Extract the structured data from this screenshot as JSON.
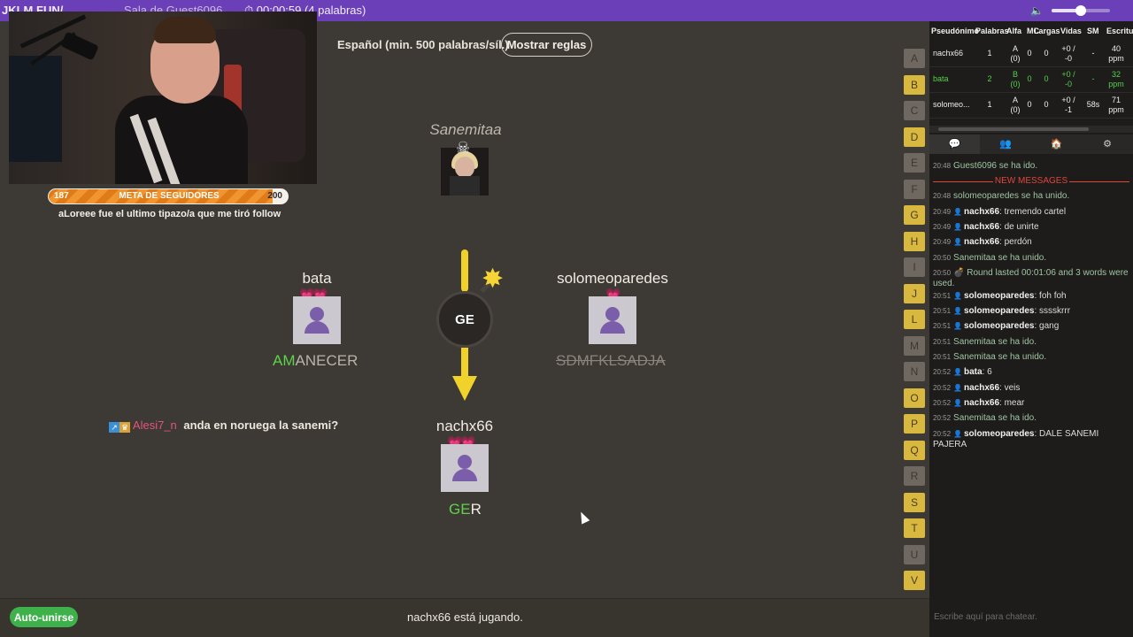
{
  "topbar": {
    "room": "JKLM.FUN/",
    "sala": "Sala de Guest6096",
    "timer": "⏱ 00:00:59 (4 palabras)",
    "volume": 0.5
  },
  "stream": {
    "goal_min": "187",
    "goal_title": "META DE SEGUIDORES",
    "goal_max": "200",
    "goal_progress": 0.93,
    "follow_msg": "aLoreee fue el ultimo tipazo/a que me tiró follow"
  },
  "rules": {
    "text": "Español (min. 500 palabras/síl.)",
    "button": "Mostrar reglas"
  },
  "players": {
    "host": {
      "name": "Sanemitaa"
    },
    "left": {
      "name": "bata",
      "word_ok": "AM",
      "word_rest": "ANECER",
      "hearts": "💗💗"
    },
    "right": {
      "name": "solomeoparedes",
      "word": "SDMFKLSADJA",
      "hearts": "💗"
    },
    "bottom": {
      "name": "nachx66",
      "word_ok": "GE",
      "word_rest": "R",
      "hearts": "💗💗"
    }
  },
  "bomb": {
    "syllable": "GE"
  },
  "ingame_chat": {
    "user": "Alesi7_n",
    "message": "anda en noruega la sanemi?"
  },
  "letters": [
    {
      "l": "A",
      "on": false
    },
    {
      "l": "B",
      "on": true
    },
    {
      "l": "C",
      "on": false
    },
    {
      "l": "D",
      "on": true
    },
    {
      "l": "E",
      "on": false
    },
    {
      "l": "F",
      "on": false
    },
    {
      "l": "G",
      "on": true
    },
    {
      "l": "H",
      "on": true
    },
    {
      "l": "I",
      "on": false
    },
    {
      "l": "J",
      "on": true
    },
    {
      "l": "L",
      "on": true
    },
    {
      "l": "M",
      "on": false
    },
    {
      "l": "N",
      "on": false
    },
    {
      "l": "O",
      "on": true
    },
    {
      "l": "P",
      "on": true
    },
    {
      "l": "Q",
      "on": true
    },
    {
      "l": "R",
      "on": false
    },
    {
      "l": "S",
      "on": true
    },
    {
      "l": "T",
      "on": true
    },
    {
      "l": "U",
      "on": false
    },
    {
      "l": "V",
      "on": true
    }
  ],
  "bottom": {
    "autojoin": "Auto-unirse",
    "status": "nachx66 está jugando."
  },
  "scoreboard": {
    "headers": [
      "Pseudónimo",
      "Palabras",
      "Alfa",
      "MC",
      "Largas",
      "Vidas",
      "SM",
      "Escritura"
    ],
    "rows": [
      {
        "name": "nachx66",
        "words": "1",
        "alfa": "A (0)",
        "mc": "0",
        "largas": "0",
        "vidas": "+0 / -0",
        "sm": "-",
        "speed": "40 ppm",
        "highlight": false
      },
      {
        "name": "bata",
        "words": "2",
        "alfa": "B (0)",
        "mc": "0",
        "largas": "0",
        "vidas": "+0 / -0",
        "sm": "-",
        "speed": "32 ppm",
        "highlight": true
      },
      {
        "name": "solomeo...",
        "words": "1",
        "alfa": "A (0)",
        "mc": "0",
        "largas": "0",
        "vidas": "+0 / -1",
        "sm": "58s",
        "speed": "71 ppm",
        "highlight": false
      }
    ]
  },
  "tabs": [
    "💬",
    "👥",
    "🏠",
    "⚙"
  ],
  "chat": {
    "new_messages": "NEW MESSAGES",
    "placeholder": "Escribe aquí para chatear.",
    "lines": [
      {
        "time": "20:48",
        "user": "",
        "text": "Guest6096 se ha ido.",
        "sys": true
      },
      {
        "time": "20:48",
        "user": "",
        "text": "solomeoparedes se ha unido.",
        "sys": true
      },
      {
        "time": "20:49",
        "user": "nachx66",
        "text": ": tremendo cartel",
        "sys": false
      },
      {
        "time": "20:49",
        "user": "nachx66",
        "text": ": de unirte",
        "sys": false
      },
      {
        "time": "20:49",
        "user": "nachx66",
        "text": ": perdón",
        "sys": false
      },
      {
        "time": "20:50",
        "user": "",
        "text": "Sanemitaa se ha unido.",
        "sys": true
      },
      {
        "time": "20:50",
        "user": "",
        "text": "💣 Round lasted 00:01:06 and 3 words were used.",
        "sys": true
      },
      {
        "time": "20:51",
        "user": "solomeoparedes",
        "text": ": foh foh",
        "sys": false
      },
      {
        "time": "20:51",
        "user": "solomeoparedes",
        "text": ": sssskrrr",
        "sys": false
      },
      {
        "time": "20:51",
        "user": "solomeoparedes",
        "text": ": gang",
        "sys": false
      },
      {
        "time": "20:51",
        "user": "",
        "text": "Sanemitaa se ha ido.",
        "sys": true
      },
      {
        "time": "20:51",
        "user": "",
        "text": "Sanemitaa se ha unido.",
        "sys": true
      },
      {
        "time": "20:52",
        "user": "bata",
        "text": ": 6",
        "sys": false
      },
      {
        "time": "20:52",
        "user": "nachx66",
        "text": ": veis",
        "sys": false
      },
      {
        "time": "20:52",
        "user": "nachx66",
        "text": ": mear",
        "sys": false
      },
      {
        "time": "20:52",
        "user": "",
        "text": "Sanemitaa se ha ido.",
        "sys": true
      },
      {
        "time": "20:52",
        "user": "solomeoparedes",
        "text": ": DALE SANEMI PAJERA",
        "sys": false
      }
    ]
  }
}
